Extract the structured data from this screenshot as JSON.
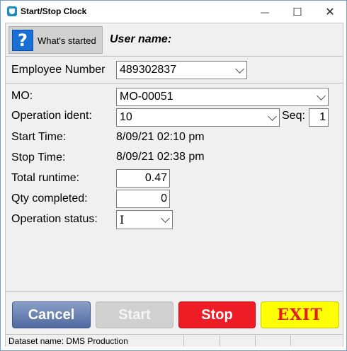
{
  "window": {
    "title": "Start/Stop Clock",
    "minimize_glyph": "—",
    "maximize_glyph": "☐",
    "close_glyph": "✕"
  },
  "toolbar": {
    "help_icon_glyph": "?",
    "whats_started_label": "What's started",
    "user_name_label": "User name:"
  },
  "form": {
    "employee_number_label": "Employee Number",
    "employee_number_value": "489302837",
    "mo_label": "MO:",
    "mo_value": "MO-00051",
    "operation_ident_label": "Operation ident:",
    "operation_ident_value": "10",
    "seq_label": "Seq:",
    "seq_value": "1",
    "start_time_label": "Start Time:",
    "start_time_value": "8/09/21 02:10 pm",
    "stop_time_label": "Stop Time:",
    "stop_time_value": "8/09/21 02:38 pm",
    "total_runtime_label": "Total runtime:",
    "total_runtime_value": "0.47",
    "qty_completed_label": "Qty completed:",
    "qty_completed_value": "0",
    "operation_status_label": "Operation status:",
    "operation_status_value": "I"
  },
  "buttons": {
    "cancel": "Cancel",
    "start": "Start",
    "stop": "Stop",
    "exit": "EXIT"
  },
  "colors": {
    "cancel": "#5a74a8",
    "start_disabled": "#d0d0d0",
    "stop": "#ee1c24",
    "exit_bg": "#ffff00",
    "exit_text": "#e02020",
    "help_icon": "#1a6fd6"
  },
  "status_bar": {
    "dataset": "Dataset name:  DMS Production"
  }
}
